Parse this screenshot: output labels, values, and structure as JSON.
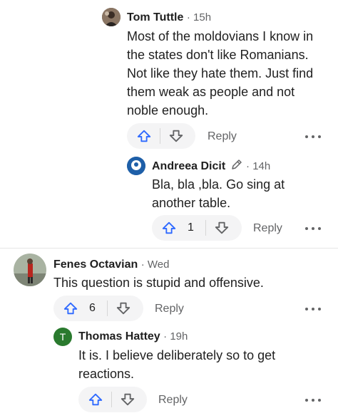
{
  "colors": {
    "upvote": "#2e69ff",
    "downvote": "#636466",
    "green_avatar": "#2a7a2e"
  },
  "comments": [
    {
      "author": "Tom Tuttle",
      "time": "· 15h",
      "lines": [
        "Most of the moldovians I know in",
        "the states don't like Romanians.",
        "Not like they hate them. Just find",
        "them weak as people and not",
        "noble enough."
      ],
      "upvotes": "",
      "reply_label": "Reply"
    },
    {
      "author": "Andreea Dicit",
      "time": "· 14h",
      "lines": [
        "Bla, bla ,bla. Go sing at",
        "another table."
      ],
      "upvotes": "1",
      "reply_label": "Reply"
    },
    {
      "author": "Fenes Octavian",
      "time": "· Wed",
      "lines": [
        "This question is stupid and offensive."
      ],
      "upvotes": "6",
      "reply_label": "Reply"
    },
    {
      "author": "Thomas Hattey",
      "avatar_letter": "T",
      "time": "· 19h",
      "lines": [
        "It is. I believe deliberately so to get",
        "reactions."
      ],
      "upvotes": "",
      "reply_label": "Reply"
    }
  ]
}
